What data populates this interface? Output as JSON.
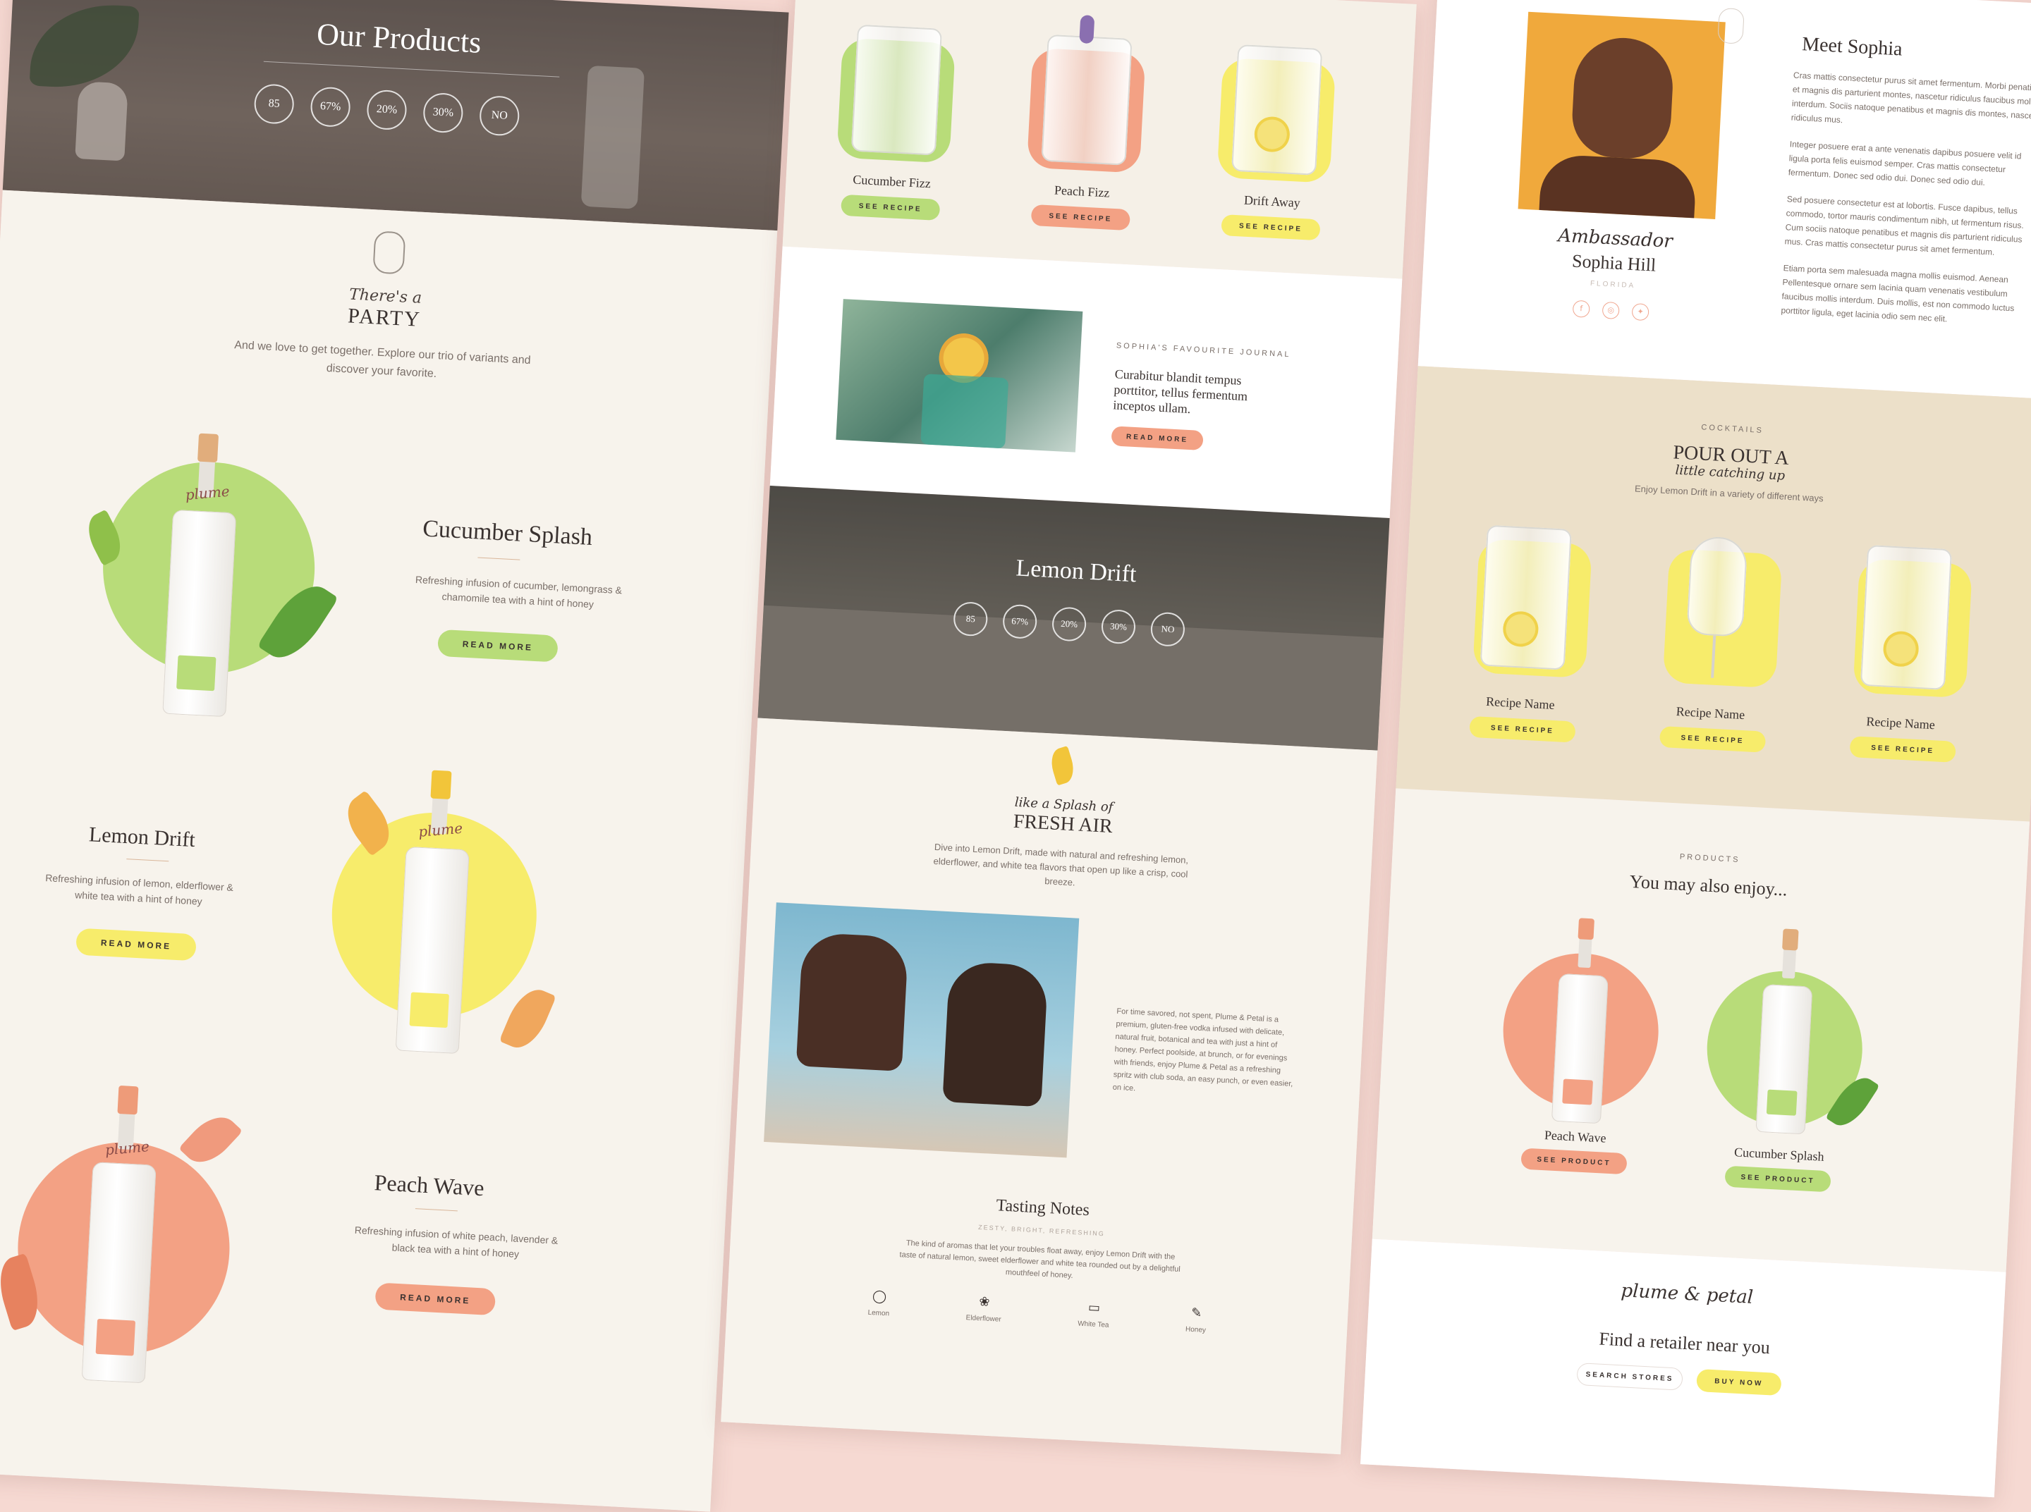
{
  "col1": {
    "hero_title": "Our Products",
    "badges": [
      "85",
      "67%",
      "20%",
      "30%",
      "NO"
    ],
    "party_script": "There's a",
    "party_title": "PARTY",
    "party_text": "And we love to get together. Explore our trio of variants and discover your favorite.",
    "products": [
      {
        "name": "Cucumber Splash",
        "desc": "Refreshing infusion of cucumber, lemongrass & chamomile tea with a hint of honey",
        "button": "READ MORE",
        "color": "#b8dc79"
      },
      {
        "name": "Lemon Drift",
        "desc": "Refreshing infusion of lemon, elderflower & white tea with a hint of honey",
        "button": "READ MORE",
        "color": "#f7ec6b"
      },
      {
        "name": "Peach Wave",
        "desc": "Refreshing infusion of white peach, lavender & black tea with a hint of honey",
        "button": "READ MORE",
        "color": "#f3a184"
      }
    ]
  },
  "col2": {
    "recipes": [
      {
        "name": "Cucumber Fizz",
        "button": "SEE RECIPE",
        "color": "#b8dc79"
      },
      {
        "name": "Peach Fizz",
        "button": "SEE RECIPE",
        "color": "#f3a184"
      },
      {
        "name": "Drift Away",
        "button": "SEE RECIPE",
        "color": "#f7ec6b"
      }
    ],
    "journal_label": "SOPHIA'S FAVOURITE JOURNAL",
    "journal_title": "Curabitur blandit tempus porttitor, tellus fermentum inceptos ullam.",
    "journal_button": "READ MORE",
    "hero_title": "Lemon Drift",
    "badges": [
      "85",
      "67%",
      "20%",
      "30%",
      "NO"
    ],
    "air_script": "like a Splash of",
    "air_title": "FRESH AIR",
    "air_text": "Dive into Lemon Drift, made with natural and refreshing lemon, elderflower, and white tea flavors that open up like a crisp, cool breeze.",
    "story_text": "For time savored, not spent, Plume & Petal is a premium, gluten-free vodka infused with delicate, natural fruit, botanical and tea with just a hint of honey. Perfect poolside, at brunch, or for evenings with friends, enjoy Plume & Petal as a refreshing spritz with club soda, an easy punch, or even easier, on ice.",
    "tasting_title": "Tasting Notes",
    "tasting_sub": "ZESTY, BRIGHT, REFRESHING",
    "tasting_text": "The kind of aromas that let your troubles float away, enjoy Lemon Drift with the taste of natural lemon, sweet elderflower and white tea rounded out by a delightful mouthfeel of honey.",
    "notes": [
      {
        "label": "Lemon",
        "icon": "lemon-icon",
        "glyph": "◯"
      },
      {
        "label": "Elderflower",
        "icon": "elderflower-icon",
        "glyph": "❀"
      },
      {
        "label": "White Tea",
        "icon": "white-tea-icon",
        "glyph": "▭"
      },
      {
        "label": "Honey",
        "icon": "honey-icon",
        "glyph": "✎"
      }
    ]
  },
  "col3": {
    "meet_title": "Meet Sophia",
    "bio": [
      "Cras mattis consectetur purus sit amet fermentum. Morbi penatibus et magnis dis parturient montes, nascetur ridiculus faucibus mollis interdum. Sociis natoque penatibus et magnis dis montes, nascetur ridiculus mus.",
      "Integer posuere erat a ante venenatis dapibus posuere velit id ligula porta felis euismod semper. Cras mattis consectetur fermentum. Donec sed odio dui. Donec sed odio dui.",
      "Sed posuere consectetur est at lobortis. Fusce dapibus, tellus commodo, tortor mauris condimentum nibh, ut fermentum risus. Cum sociis natoque penatibus et magnis dis parturient ridiculus mus. Cras mattis consectetur purus sit amet fermentum.",
      "Etiam porta sem malesuada magna mollis euismod. Aenean Pellentesque ornare sem lacinia quam venenatis vestibulum faucibus mollis interdum. Duis mollis, est non commodo luctus porttitor ligula, eget lacinia odio sem nec elit."
    ],
    "ambassador_script": "Ambassador",
    "ambassador_name": "Sophia Hill",
    "ambassador_location": "FLORIDA",
    "cocktails_label": "COCKTAILS",
    "cocktails_title": "POUR OUT A",
    "cocktails_script": "little catching up",
    "cocktails_sub": "Enjoy Lemon Drift in a variety of different ways",
    "cocktails": [
      {
        "name": "Recipe Name",
        "button": "SEE RECIPE"
      },
      {
        "name": "Recipe Name",
        "button": "SEE RECIPE"
      },
      {
        "name": "Recipe Name",
        "button": "SEE RECIPE"
      }
    ],
    "products_label": "PRODUCTS",
    "products_title": "You may also enjoy...",
    "related": [
      {
        "name": "Peach Wave",
        "button": "SEE PRODUCT",
        "color": "#f3a184"
      },
      {
        "name": "Cucumber Splash",
        "button": "SEE PRODUCT",
        "color": "#b8dc79"
      }
    ],
    "brand_logo": "plume & petal",
    "retailer_title": "Find a retailer near you",
    "search_button": "SEARCH STORES",
    "buy_button": "BUY NOW"
  }
}
